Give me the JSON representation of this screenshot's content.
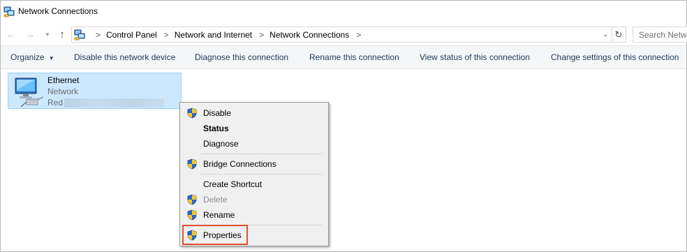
{
  "window": {
    "title": "Network Connections",
    "app_icon": "network-connections-icon"
  },
  "nav": {
    "back_icon": "back-arrow-icon",
    "forward_icon": "forward-arrow-icon",
    "recent_icon": "chevron-down-icon",
    "up_icon": "up-arrow-icon"
  },
  "address": {
    "breadcrumbs": [
      "Control Panel",
      "Network and Internet",
      "Network Connections"
    ],
    "separator": ">",
    "dropdown_icon": "chevron-down-icon",
    "refresh_icon": "refresh-icon"
  },
  "search": {
    "placeholder": "Search Network Connections"
  },
  "commands": {
    "organize": "Organize",
    "disable": "Disable this network device",
    "diagnose": "Diagnose this connection",
    "rename": "Rename this connection",
    "view_status": "View status of this connection",
    "change_settings": "Change settings of this connection"
  },
  "connection": {
    "name": "Ethernet",
    "type": "Network",
    "status_prefix": "Red",
    "icon": "ethernet-adapter-icon"
  },
  "context_menu": {
    "items": [
      {
        "label": "Disable",
        "shield": true,
        "bold": false,
        "disabled": false
      },
      {
        "label": "Status",
        "shield": false,
        "bold": true,
        "disabled": false
      },
      {
        "label": "Diagnose",
        "shield": false,
        "bold": false,
        "disabled": false
      },
      {
        "label": "Bridge Connections",
        "shield": true,
        "bold": false,
        "disabled": false
      },
      {
        "label": "Create Shortcut",
        "shield": false,
        "bold": false,
        "disabled": false
      },
      {
        "label": "Delete",
        "shield": true,
        "bold": false,
        "disabled": true
      },
      {
        "label": "Rename",
        "shield": true,
        "bold": false,
        "disabled": false
      },
      {
        "label": "Properties",
        "shield": true,
        "bold": false,
        "disabled": false
      }
    ],
    "highlighted": "Properties",
    "highlight_color": "#e0502d"
  },
  "colors": {
    "selection_bg": "#cce8ff",
    "selection_border": "#99d1ff",
    "command_text": "#1e395b"
  }
}
